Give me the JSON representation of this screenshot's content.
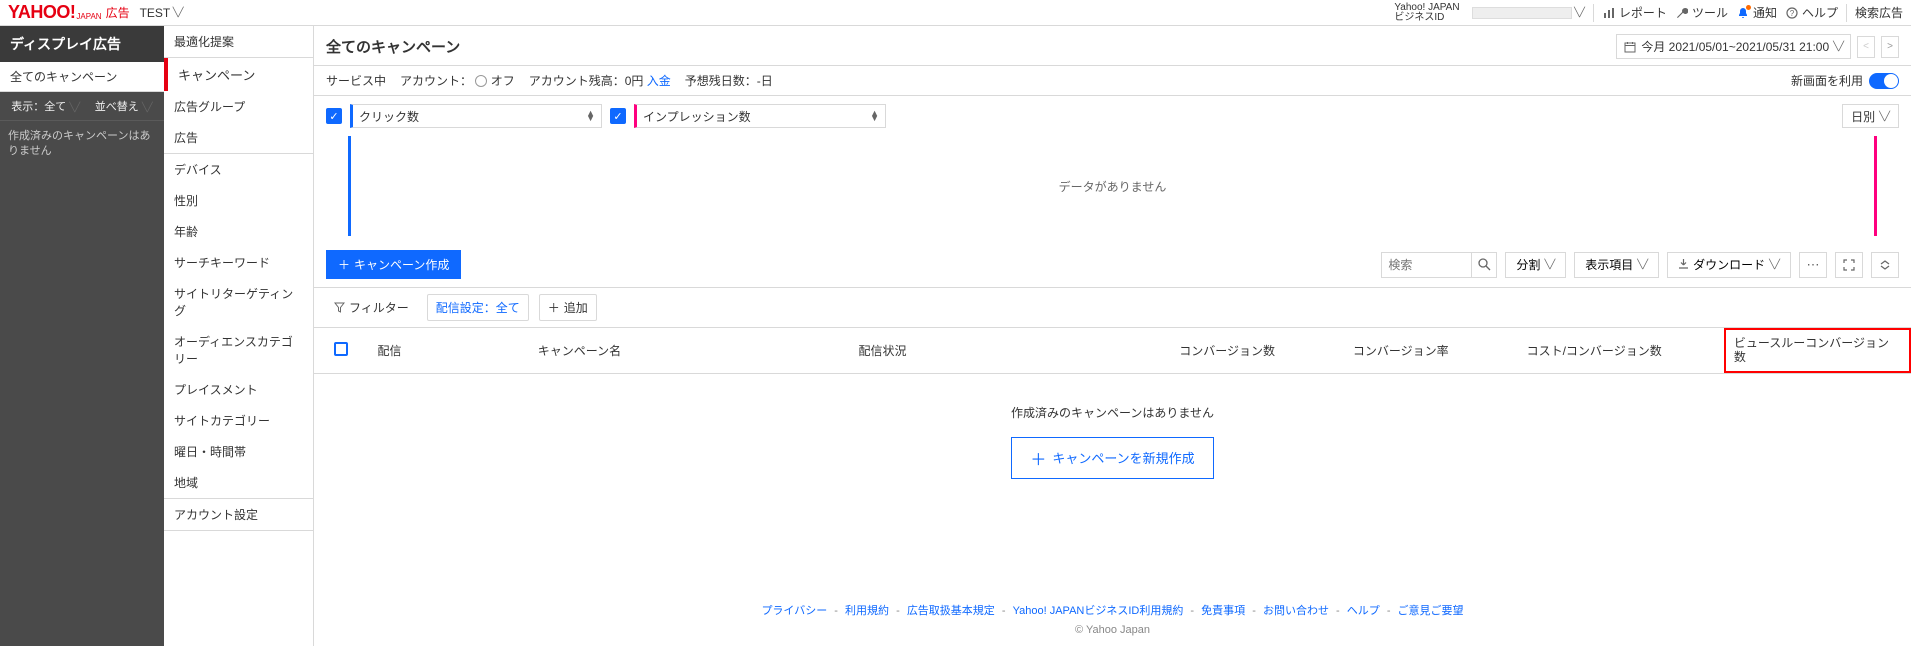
{
  "header": {
    "logo_main": "YAHOO!",
    "logo_sub": "JAPAN",
    "logo_ad": "広告",
    "account_name": "TEST",
    "biz_label1": "Yahoo! JAPAN",
    "biz_label2": "ビジネスID",
    "links": {
      "report": "レポート",
      "tool": "ツール",
      "notice": "通知",
      "help": "ヘルプ",
      "search_ad": "検索広告"
    }
  },
  "left_dark": {
    "title": "ディスプレイ広告",
    "all_campaigns": "全てのキャンペーン",
    "show_label": "表示：全て",
    "sort_label": "並べ替え",
    "empty": "作成済みのキャンペーンはありません"
  },
  "menu": {
    "items": [
      "最適化提案",
      "キャンペーン",
      "広告グループ",
      "広告",
      "デバイス",
      "性別",
      "年齢",
      "サーチキーワード",
      "サイトリターゲティング",
      "オーディエンスカテゴリー",
      "プレイスメント",
      "サイトカテゴリー",
      "曜日・時間帯",
      "地域",
      "アカウント設定"
    ],
    "active_index": 1
  },
  "main": {
    "title": "全てのキャンペーン",
    "date_label": "今月 2021/05/01~2021/05/31 21:00",
    "new_ui_label": "新画面を利用",
    "status": {
      "service": "サービス中",
      "account_label": "アカウント：",
      "off_label": "オフ",
      "balance_label": "アカウント残高：0円",
      "deposit": "入金",
      "remaining": "予想残日数：-日"
    },
    "metrics": {
      "m1": "クリック数",
      "m2": "インプレッション数",
      "daily": "日別"
    },
    "chart_empty": "データがありません",
    "toolbar": {
      "create": "キャンペーン作成",
      "search_placeholder": "検索",
      "split": "分割",
      "columns": "表示項目",
      "download": "ダウンロード"
    },
    "filter": {
      "label": "フィルター",
      "delivery": "配信設定：全て",
      "add": "追加"
    },
    "columns": [
      "配信",
      "キャンペーン名",
      "配信状況",
      "コンバージョン数",
      "コンバージョン率",
      "コスト/コンバージョン数",
      "ビュースルーコンバージョン数"
    ],
    "empty": {
      "msg": "作成済みのキャンペーンはありません",
      "create": "キャンペーンを新規作成"
    }
  },
  "footer": {
    "links": [
      "プライバシー",
      "利用規約",
      "広告取扱基本規定",
      "Yahoo! JAPANビジネスID利用規約",
      "免責事項",
      "お問い合わせ",
      "ヘルプ",
      "ご意見ご要望"
    ],
    "sep": "-",
    "copyright": "© Yahoo Japan"
  }
}
